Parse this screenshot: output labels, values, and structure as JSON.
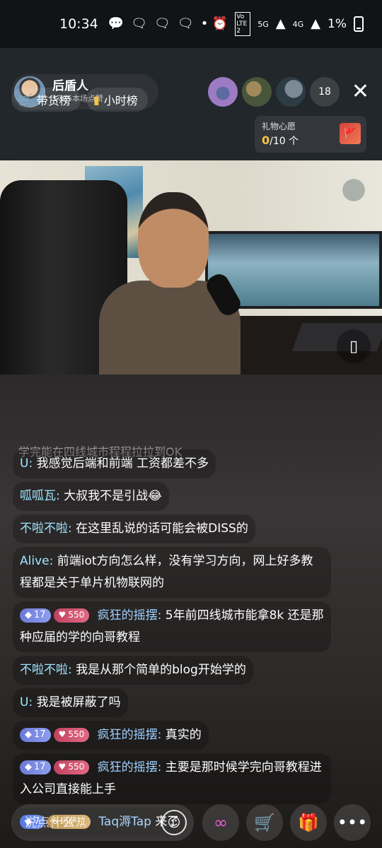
{
  "status_bar": {
    "time": "10:34",
    "notif_icons": [
      "chat-bubble-icon",
      "wechat-icon",
      "wechat-icon",
      "wechat-icon"
    ],
    "dot": "•",
    "network": "5G",
    "network2": "4G",
    "volte": "Vo LTE 2",
    "battery": "1%"
  },
  "header": {
    "host_name": "后盾人",
    "host_likes": "1795本场点赞",
    "viewer_count": "18",
    "rank_buttons": [
      "带货榜",
      "小时榜"
    ],
    "wish": {
      "title": "礼物心愿",
      "current": "0",
      "total": "/10 个"
    }
  },
  "chat": {
    "partial": "学完能在四线城市程程拉拉到OK",
    "messages": [
      {
        "user": "U:",
        "text": "我感觉后端和前端 工资都差不多"
      },
      {
        "user": "呱呱瓦:",
        "text": "大叔我不是引战😂"
      },
      {
        "user": "不啦不啦:",
        "text": "在这里乱说的话可能会被DISS的"
      },
      {
        "user": "Alive:",
        "text": "前端iot方向怎么样，没有学习方向，网上好多教程都是关于单片机物联网的"
      },
      {
        "level": "17",
        "fan": "550",
        "user": "疯狂的摇摆:",
        "text": "5年前四线城市能拿8k 还是那种应届的学的向哥教程"
      },
      {
        "user": "不啦不啦:",
        "text": "我是从那个简单的blog开始学的"
      },
      {
        "user": "U:",
        "text": "我是被屏蔽了吗"
      },
      {
        "level": "17",
        "fan": "550",
        "user": "疯狂的摇摆:",
        "text": "真实的"
      },
      {
        "level": "17",
        "fan": "550",
        "user": "疯狂的摇摆:",
        "text": "主要是那时候学完向哥教程进入公司直接能上手"
      }
    ],
    "join": {
      "level": "7",
      "badge": "玛萨拉",
      "badge_level": "6",
      "name": "Taq溽Tap",
      "text": "来了"
    }
  },
  "bottom": {
    "placeholder": "说点什么..."
  }
}
